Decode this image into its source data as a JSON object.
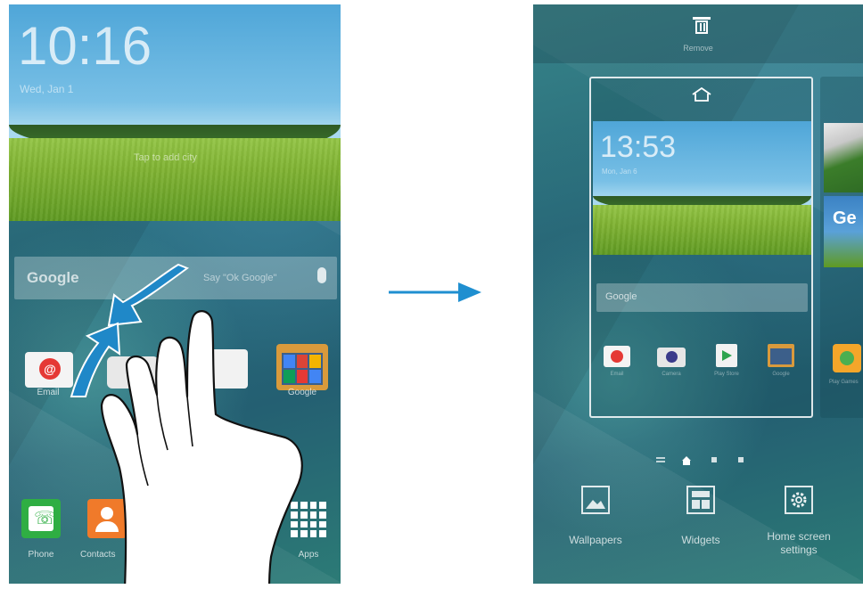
{
  "left_screen": {
    "clock": "10:16",
    "date": "Wed, Jan 1",
    "tap_hint": "Tap to add city",
    "search": {
      "brand": "Google",
      "hint": "Say \"Ok Google\""
    },
    "apps": [
      {
        "label": "Email",
        "icon": "email-icon"
      },
      {
        "label": "",
        "icon": "camera-icon"
      },
      {
        "label": "",
        "icon": "play-store-icon"
      },
      {
        "label": "Google",
        "icon": "google-folder-icon"
      }
    ],
    "dock": [
      {
        "label": "Phone",
        "icon": "phone-icon"
      },
      {
        "label": "Contacts",
        "icon": "contacts-icon"
      },
      {
        "label": "Apps",
        "icon": "apps-grid-icon"
      }
    ]
  },
  "right_screen": {
    "remove_label": "Remove",
    "preview": {
      "clock": "13:53",
      "date": "Mon, Jan 6",
      "search_brand": "Google",
      "apps": [
        {
          "label": "Email",
          "icon": "email-icon"
        },
        {
          "label": "Camera",
          "icon": "camera-icon"
        },
        {
          "label": "Play Store",
          "icon": "play-store-icon"
        },
        {
          "label": "Google",
          "icon": "google-folder-icon"
        }
      ]
    },
    "next_preview": {
      "label": "Play Games",
      "text": "Ge"
    },
    "options": [
      {
        "label": "Wallpapers",
        "icon": "wallpaper-icon"
      },
      {
        "label": "Widgets",
        "icon": "widgets-icon"
      },
      {
        "label": "Home screen\nsettings",
        "icon": "gear-icon"
      }
    ]
  },
  "colors": {
    "arrow": "#1f8fd0",
    "gesture": "#1f88c8"
  }
}
